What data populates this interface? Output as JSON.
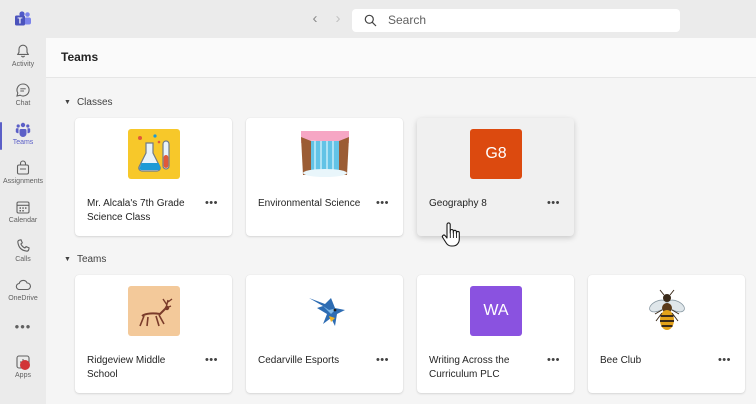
{
  "search": {
    "placeholder": "Search"
  },
  "rail": {
    "items": [
      {
        "label": "Activity",
        "icon": "bell-icon"
      },
      {
        "label": "Chat",
        "icon": "chat-icon"
      },
      {
        "label": "Teams",
        "icon": "teams-icon",
        "active": true
      },
      {
        "label": "Assignments",
        "icon": "assignments-icon"
      },
      {
        "label": "Calendar",
        "icon": "calendar-icon"
      },
      {
        "label": "Calls",
        "icon": "phone-icon"
      },
      {
        "label": "OneDrive",
        "icon": "cloud-icon"
      },
      {
        "label": "Apps",
        "icon": "apps-icon"
      }
    ],
    "more_label": "•••"
  },
  "page": {
    "title": "Teams"
  },
  "sections": {
    "classes": {
      "title": "Classes",
      "cards": [
        {
          "name": "Mr. Alcala's 7th Grade Science Class",
          "thumb": "science-beakers-icon",
          "more": "•••"
        },
        {
          "name": "Environmental Science",
          "thumb": "waterfall-icon",
          "more": "•••"
        },
        {
          "name": "Geography 8",
          "initials": "G8",
          "color": "#dc4a0f",
          "more": "•••"
        }
      ]
    },
    "teams": {
      "title": "Teams",
      "cards": [
        {
          "name": "Ridgeview Middle School",
          "thumb": "deer-icon",
          "more": "•••"
        },
        {
          "name": "Cedarville Esports",
          "thumb": "dragon-logo-icon",
          "more": "•••"
        },
        {
          "name": "Writing Across the Curriculum PLC",
          "initials": "WA",
          "color": "#8a52e0",
          "more": "•••"
        },
        {
          "name": "Bee Club",
          "thumb": "bee-icon",
          "more": "•••"
        }
      ]
    }
  },
  "colors": {
    "accent": "#5b5fc7",
    "rail_bg": "#ebebeb",
    "notify": "#d13438"
  }
}
